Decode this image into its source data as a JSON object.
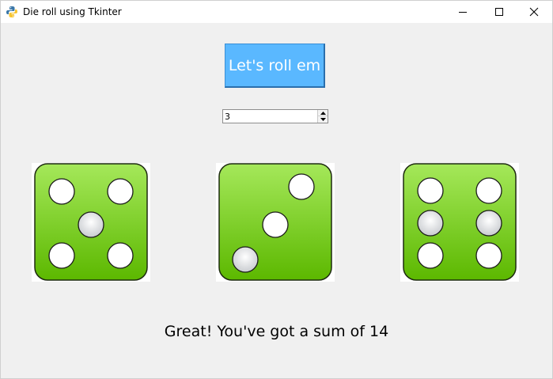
{
  "window": {
    "title": "Die roll using Tkinter",
    "icon": "python-icon"
  },
  "controls": {
    "roll_button_label": "Let's roll em",
    "dice_count_value": "3"
  },
  "dice": [
    {
      "value": 5
    },
    {
      "value": 3
    },
    {
      "value": 6
    }
  ],
  "result": {
    "text": "Great! You've got a sum of 14"
  },
  "colors": {
    "button": "#5ab8ff",
    "die_top": "#a5e85a",
    "die_bottom": "#5cb800",
    "background": "#f0f0f0"
  }
}
